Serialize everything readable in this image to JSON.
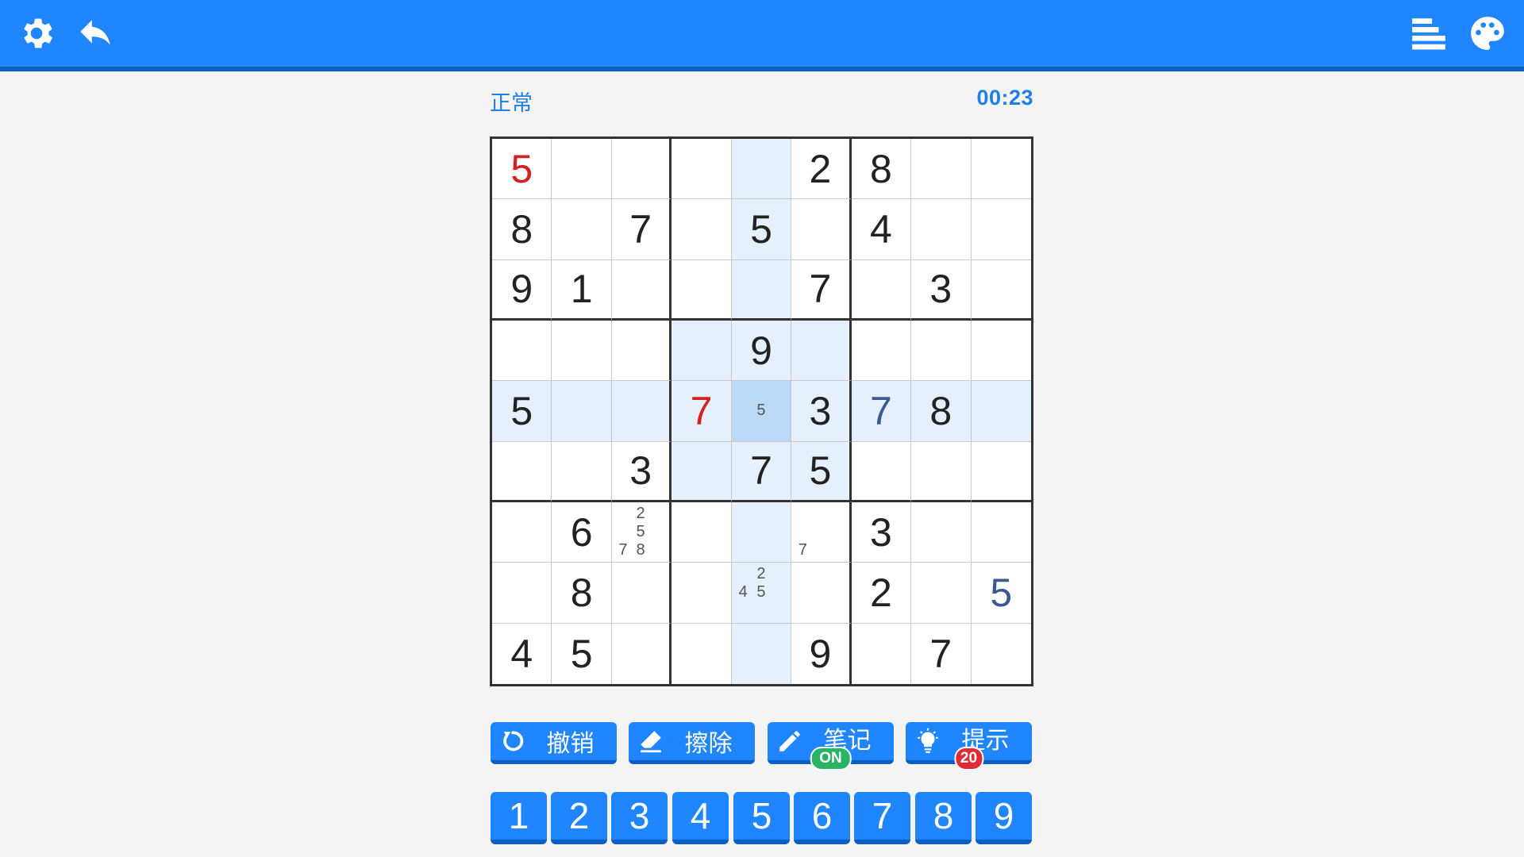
{
  "toolbar": {
    "left_icons": [
      "gear-icon",
      "back-arrow-icon"
    ],
    "right_icons": [
      "align-left-icon",
      "palette-icon"
    ]
  },
  "header": {
    "difficulty": "正常",
    "timer": "00:23"
  },
  "colors": {
    "primary": "#1f86ff",
    "primary_dark": "#0d5ec2",
    "given_digit": "#222222",
    "error_digit": "#d62020",
    "user_digit": "#3b5a94",
    "highlight": "#e6f0fc",
    "selected": "#bcd9f7",
    "badge_on": "#28b463",
    "badge_count": "#e02a35"
  },
  "board": {
    "grid": [
      [
        "5",
        "",
        "",
        "",
        "",
        "2",
        "8",
        "",
        ""
      ],
      [
        "8",
        "",
        "7",
        "",
        "5",
        "",
        "4",
        "",
        ""
      ],
      [
        "9",
        "1",
        "",
        "",
        "",
        "7",
        "",
        "3",
        ""
      ],
      [
        "",
        "",
        "",
        "",
        "9",
        "",
        "",
        "",
        ""
      ],
      [
        "5",
        "",
        "",
        "7",
        "",
        "3",
        "7",
        "8",
        ""
      ],
      [
        "",
        "",
        "3",
        "",
        "7",
        "5",
        "",
        "",
        ""
      ],
      [
        "",
        "6",
        "",
        "",
        "",
        "",
        "3",
        "",
        ""
      ],
      [
        "",
        "8",
        "",
        "",
        "",
        "",
        "2",
        "",
        "5"
      ],
      [
        "4",
        "5",
        "",
        "",
        "",
        "9",
        "",
        "7",
        ""
      ]
    ],
    "cell_types": [
      [
        "error",
        "",
        "",
        "",
        "",
        "given",
        "given",
        "",
        ""
      ],
      [
        "given",
        "",
        "given",
        "",
        "given",
        "",
        "given",
        "",
        ""
      ],
      [
        "given",
        "given",
        "",
        "",
        "",
        "given",
        "",
        "given",
        ""
      ],
      [
        "",
        "",
        "",
        "",
        "given",
        "",
        "",
        "",
        ""
      ],
      [
        "given",
        "",
        "",
        "error",
        "",
        "given",
        "user",
        "given",
        ""
      ],
      [
        "",
        "",
        "given",
        "",
        "given",
        "given",
        "",
        "",
        ""
      ],
      [
        "",
        "given",
        "",
        "",
        "",
        "",
        "given",
        "",
        ""
      ],
      [
        "",
        "given",
        "",
        "",
        "",
        "",
        "given",
        "",
        "user"
      ],
      [
        "given",
        "given",
        "",
        "",
        "",
        "given",
        "",
        "given",
        ""
      ]
    ],
    "notes": [
      {
        "row": 4,
        "col": 4,
        "digits": [
          "5"
        ]
      },
      {
        "row": 6,
        "col": 2,
        "digits": [
          "2",
          "5",
          "7",
          "8"
        ]
      },
      {
        "row": 6,
        "col": 5,
        "digits": [
          "7"
        ]
      },
      {
        "row": 7,
        "col": 4,
        "digits": [
          "2",
          "4",
          "5"
        ]
      }
    ],
    "selected": {
      "row": 4,
      "col": 4
    }
  },
  "tools": [
    {
      "name": "undo",
      "icon": "refresh-icon",
      "label": "撤销",
      "badge": ""
    },
    {
      "name": "erase",
      "icon": "eraser-icon",
      "label": "擦除",
      "badge": ""
    },
    {
      "name": "notes",
      "icon": "pencil-icon",
      "label": "笔记",
      "badge": "ON"
    },
    {
      "name": "hint",
      "icon": "lightbulb-icon",
      "label": "提示",
      "badge": "20"
    }
  ],
  "numbers": [
    "1",
    "2",
    "3",
    "4",
    "5",
    "6",
    "7",
    "8",
    "9"
  ]
}
